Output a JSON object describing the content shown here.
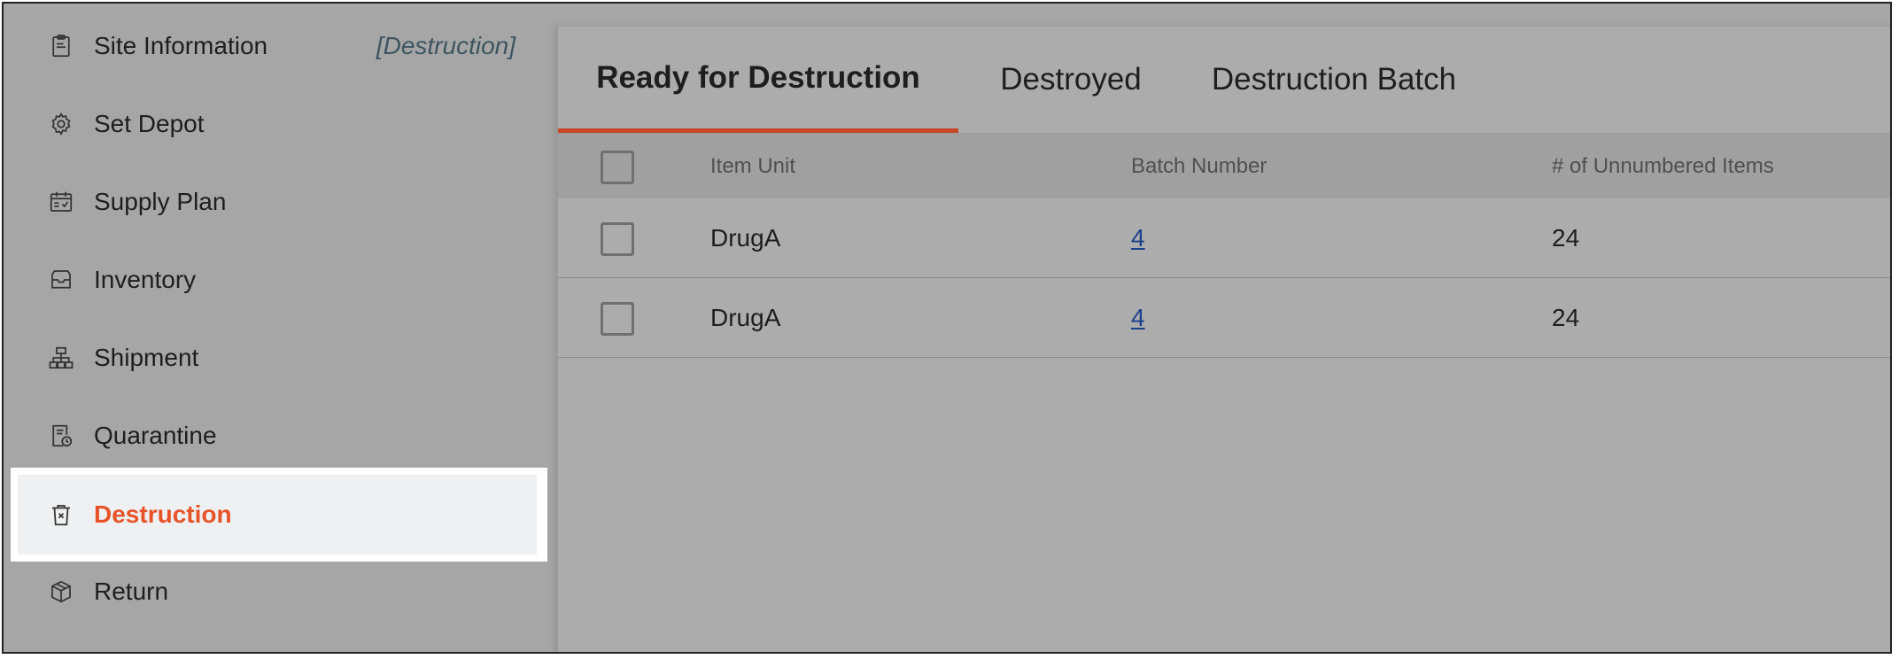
{
  "sidebar": {
    "items": [
      {
        "label": "Site Information",
        "icon": "clipboard-icon"
      },
      {
        "label": "Set Depot",
        "icon": "gear-icon"
      },
      {
        "label": "Supply Plan",
        "icon": "calendar-check-icon"
      },
      {
        "label": "Inventory",
        "icon": "inbox-icon"
      },
      {
        "label": "Shipment",
        "icon": "sitemap-icon"
      },
      {
        "label": "Quarantine",
        "icon": "document-clock-icon"
      },
      {
        "label": "Destruction",
        "icon": "trash-x-icon",
        "active": true
      },
      {
        "label": "Return",
        "icon": "box-icon"
      }
    ],
    "context_note": "[Destruction]"
  },
  "tabs": [
    {
      "label": "Ready for Destruction",
      "active": true
    },
    {
      "label": "Destroyed"
    },
    {
      "label": "Destruction Batch"
    }
  ],
  "table": {
    "columns": [
      "Item Unit",
      "Batch Number",
      "# of Unnumbered Items"
    ],
    "rows": [
      {
        "item_unit": "DrugA",
        "batch_number": "4",
        "unnumbered": "24"
      },
      {
        "item_unit": "DrugA",
        "batch_number": "4",
        "unnumbered": "24"
      }
    ]
  },
  "colors": {
    "active_accent": "#e8542a",
    "tab_underline": "#c8462a",
    "link": "#1b3f8a"
  }
}
